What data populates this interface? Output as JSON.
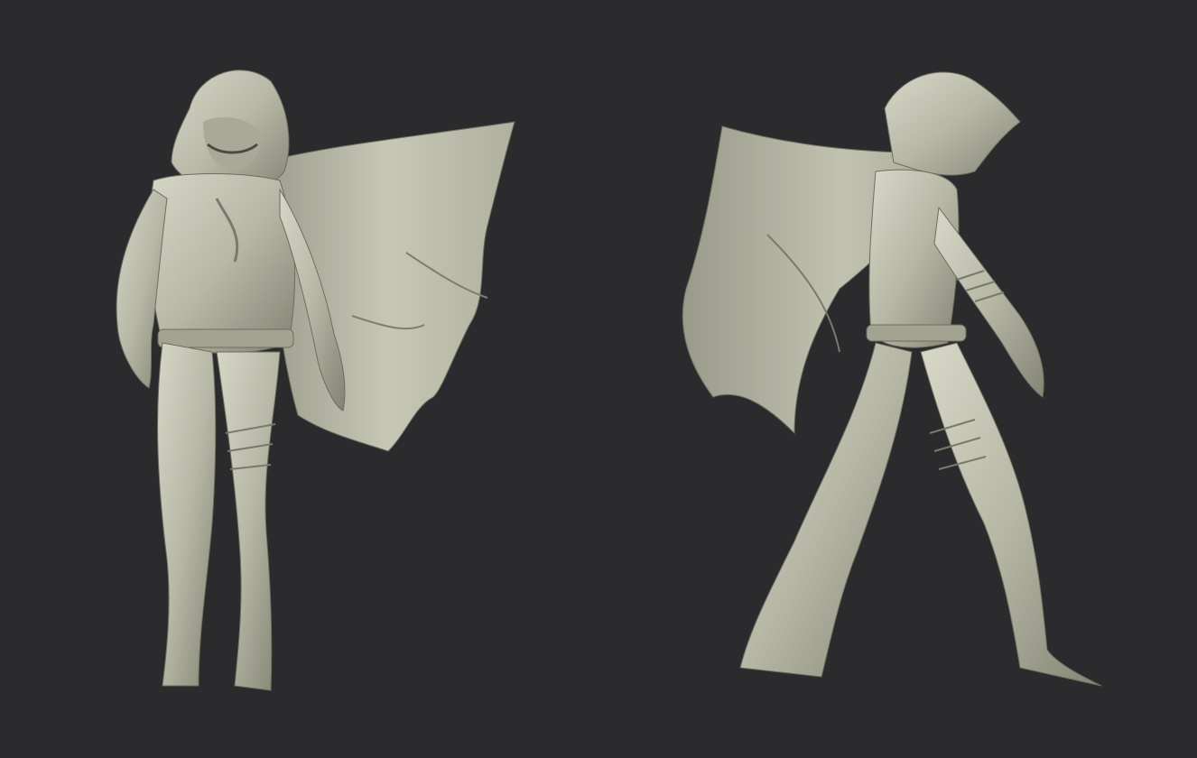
{
  "scene": {
    "background_color": "#2b2b2d",
    "clay_color": "#b9b9a8",
    "clay_highlight": "#d9d9c9",
    "clay_shadow": "#6f6f62",
    "views": [
      {
        "name": "front-view"
      },
      {
        "name": "side-view"
      }
    ]
  }
}
